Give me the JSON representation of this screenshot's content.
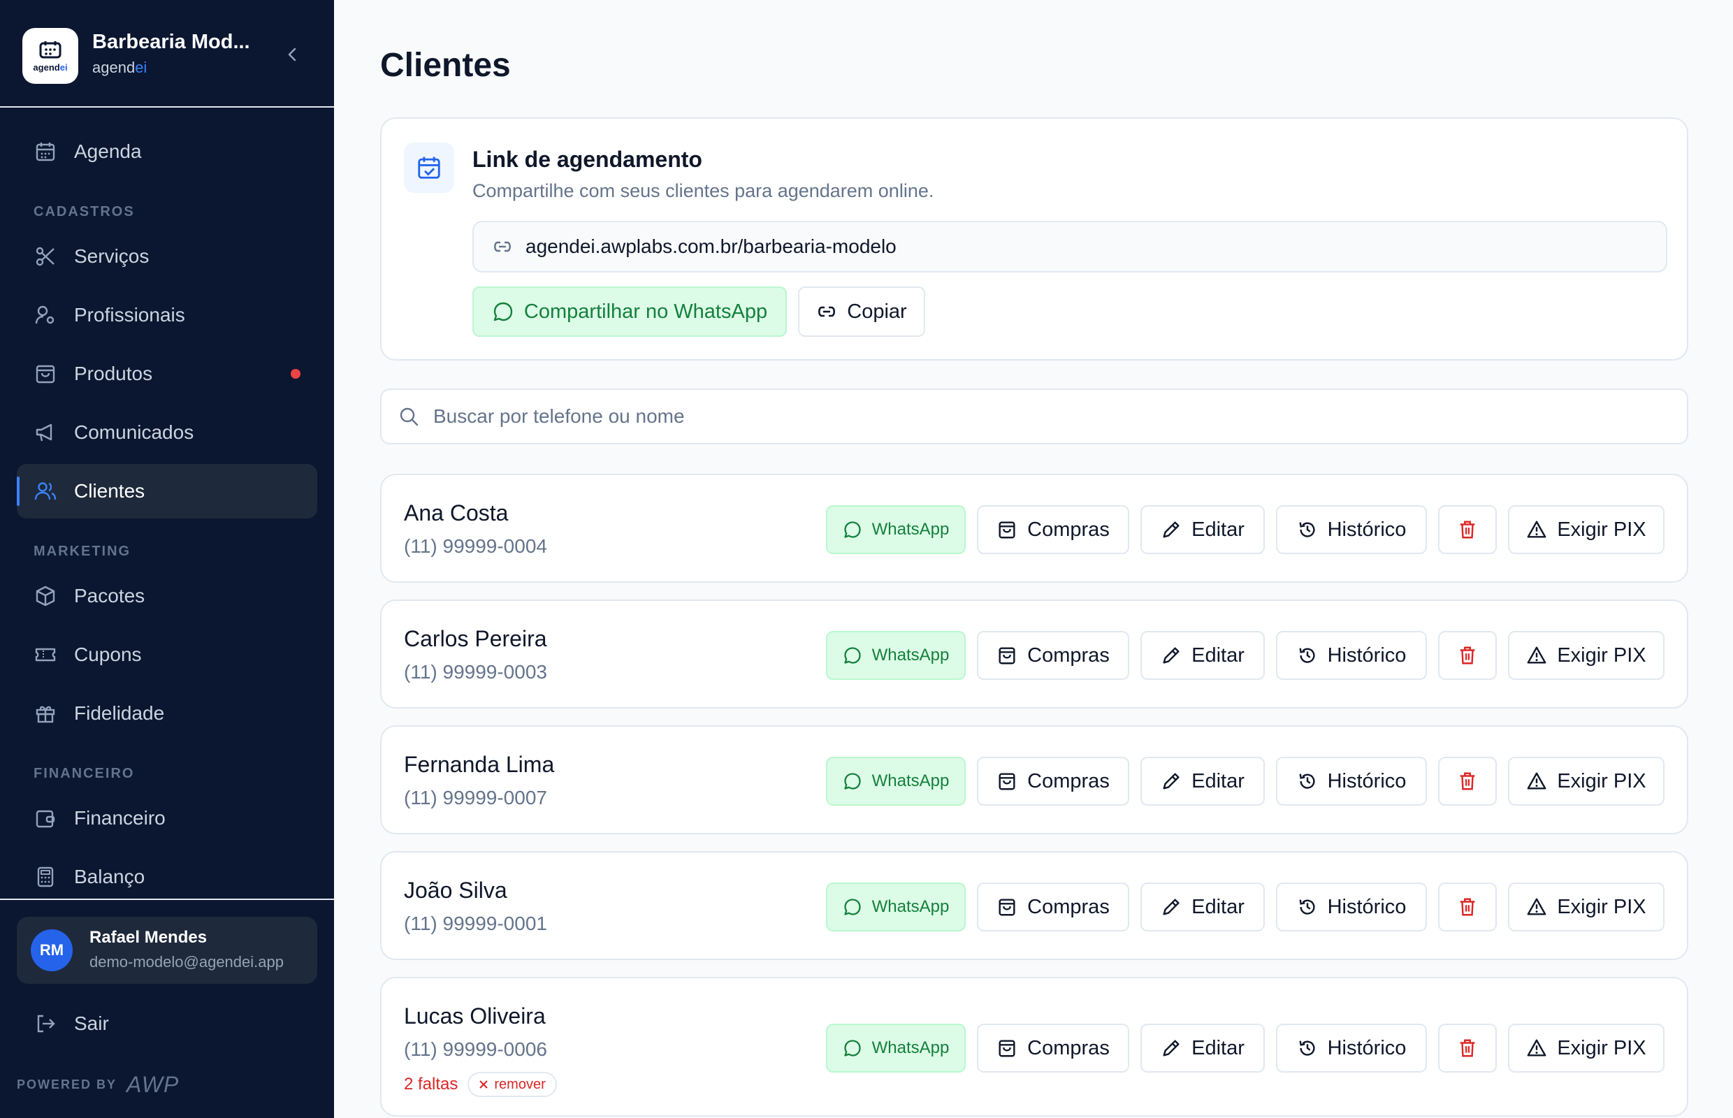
{
  "brand": {
    "name": "Barbearia Mod...",
    "sub_a": "agend",
    "sub_b": "ei",
    "logo_a": "agend",
    "logo_b": "ei"
  },
  "sidebar": {
    "agenda": "Agenda",
    "section_cadastros": "CADASTROS",
    "servicos": "Serviços",
    "profissionais": "Profissionais",
    "produtos": "Produtos",
    "comunicados": "Comunicados",
    "clientes": "Clientes",
    "section_marketing": "MARKETING",
    "pacotes": "Pacotes",
    "cupons": "Cupons",
    "fidelidade": "Fidelidade",
    "section_financeiro": "FINANCEIRO",
    "financeiro": "Financeiro",
    "balanco": "Balanço",
    "logout": "Sair",
    "powered_by": "POWERED BY",
    "powered_brand": "AWP"
  },
  "user": {
    "initials": "RM",
    "name": "Rafael Mendes",
    "email": "demo-modelo@agendei.app"
  },
  "page": {
    "title": "Clientes"
  },
  "link_card": {
    "title": "Link de agendamento",
    "description": "Compartilhe com seus clientes para agendarem online.",
    "url": "agendei.awplabs.com.br/barbearia-modelo",
    "share_label": "Compartilhar no WhatsApp",
    "copy_label": "Copiar"
  },
  "search": {
    "placeholder": "Buscar por telefone ou nome"
  },
  "actions": {
    "whatsapp": "WhatsApp",
    "compras": "Compras",
    "editar": "Editar",
    "historico": "Histórico",
    "exigir_pix": "Exigir PIX"
  },
  "clients": [
    {
      "name": "Ana Costa",
      "phone": "(11) 99999-0004"
    },
    {
      "name": "Carlos Pereira",
      "phone": "(11) 99999-0003"
    },
    {
      "name": "Fernanda Lima",
      "phone": "(11) 99999-0007"
    },
    {
      "name": "João Silva",
      "phone": "(11) 99999-0001"
    },
    {
      "name": "Lucas Oliveira",
      "phone": "(11) 99999-0006",
      "faltas": "2 faltas",
      "remover": "remover"
    }
  ],
  "colors": {
    "sidebar_bg": "#0b1630",
    "accent": "#2563eb",
    "whatsapp_green": "#15803d",
    "danger": "#dc2626",
    "badge_dot": "#ef4444"
  },
  "icons": {
    "agenda": "calendar-icon",
    "servicos": "scissors-icon",
    "profissionais": "user-cog-icon",
    "produtos": "shopping-bag-icon",
    "comunicados": "megaphone-icon",
    "clientes": "users-icon",
    "pacotes": "package-icon",
    "cupons": "ticket-icon",
    "fidelidade": "gift-icon",
    "financeiro": "wallet-icon",
    "balanco": "calculator-icon",
    "logout": "logout-icon"
  }
}
